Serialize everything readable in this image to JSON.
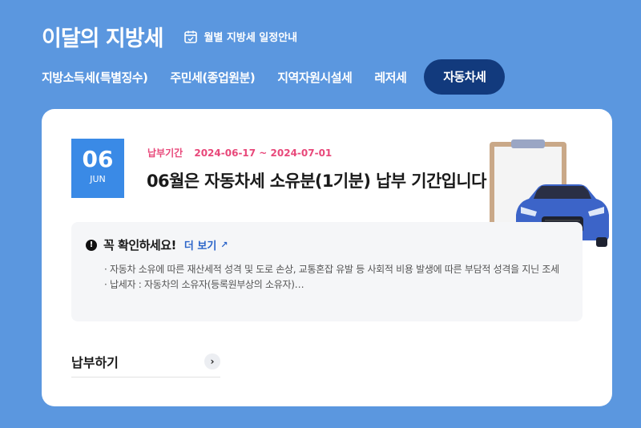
{
  "header": {
    "title": "이달의 지방세",
    "schedule_label": "월별 지방세 일정안내"
  },
  "tabs": [
    {
      "label": "지방소득세(특별징수)"
    },
    {
      "label": "주민세(종업원분)"
    },
    {
      "label": "지역자원시설세"
    },
    {
      "label": "레저세"
    },
    {
      "label": "자동차세",
      "active": true
    }
  ],
  "card": {
    "date": {
      "day": "06",
      "month": "JUN"
    },
    "period_label": "납부기간",
    "period_value": "2024-06-17 ~ 2024-07-01",
    "headline": "06월은 자동차세 소유분(1기분) 납부 기간입니다",
    "notice": {
      "title": "꼭 확인하세요!",
      "more_label": "더 보기",
      "lines": [
        "· 자동차 소유에 따른 재산세적 성격 및 도로 손상, 교통혼잡 유발 등 사회적 비용 발생에 따른 부담적 성격을 지닌 조세",
        "· 납세자 : 자동차의 소유자(등록원부상의 소유자)…"
      ]
    },
    "pay_label": "납부하기"
  },
  "colors": {
    "background": "#5b97df",
    "active_tab": "#123a7d",
    "date_badge": "#3a8ae6",
    "period_text": "#e8487a",
    "link": "#2a64c9"
  },
  "icons": [
    "calendar-check-icon",
    "warning-icon",
    "arrow-icon",
    "chevron-right-icon"
  ]
}
